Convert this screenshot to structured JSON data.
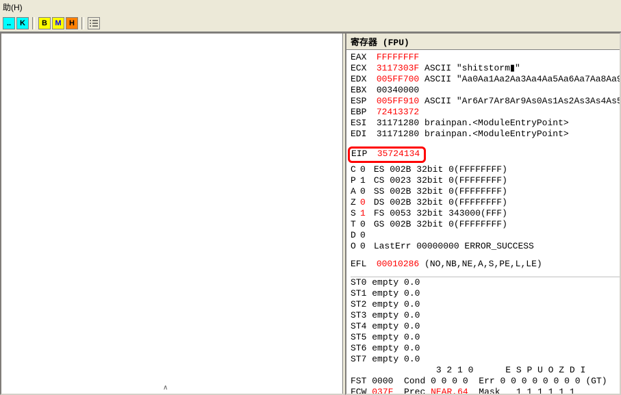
{
  "menu": {
    "help": "助(H)"
  },
  "toolbar": {
    "k": "K",
    "b": "B",
    "m": "M",
    "h": "H"
  },
  "panel": {
    "title": "寄存器 (FPU)"
  },
  "reg": {
    "eax": {
      "name": "EAX",
      "val": "FFFFFFFF"
    },
    "ecx": {
      "name": "ECX",
      "val": "3117303F",
      "asc": "ASCII \"shitstorm▮\""
    },
    "edx": {
      "name": "EDX",
      "val": "005FF700",
      "asc": "ASCII \"Aa0Aa1Aa2Aa3Aa4Aa5Aa6Aa7Aa8Aa9"
    },
    "ebx": {
      "name": "EBX",
      "val": "00340000"
    },
    "esp": {
      "name": "ESP",
      "val": "005FF910",
      "asc": "ASCII \"Ar6Ar7Ar8Ar9As0As1As2As3As4As5"
    },
    "ebp": {
      "name": "EBP",
      "val": "72413372"
    },
    "esi": {
      "name": "ESI",
      "val": "31171280",
      "asc": "brainpan.<ModuleEntryPoint>"
    },
    "edi": {
      "name": "EDI",
      "val": "31171280",
      "asc": "brainpan.<ModuleEntryPoint>"
    },
    "eip": {
      "name": "EIP",
      "val": "35724134"
    }
  },
  "flags": {
    "c": {
      "name": "C",
      "val": "0",
      "seg": "ES",
      "segval": "002B",
      "bits": "32bit",
      "range": "0(FFFFFFFF)"
    },
    "p": {
      "name": "P",
      "val": "1",
      "seg": "CS",
      "segval": "0023",
      "bits": "32bit",
      "range": "0(FFFFFFFF)"
    },
    "a": {
      "name": "A",
      "val": "0",
      "seg": "SS",
      "segval": "002B",
      "bits": "32bit",
      "range": "0(FFFFFFFF)"
    },
    "z": {
      "name": "Z",
      "val": "0",
      "seg": "DS",
      "segval": "002B",
      "bits": "32bit",
      "range": "0(FFFFFFFF)"
    },
    "s": {
      "name": "S",
      "val": "1",
      "seg": "FS",
      "segval": "0053",
      "bits": "32bit",
      "range": "343000(FFF)"
    },
    "t": {
      "name": "T",
      "val": "0",
      "seg": "GS",
      "segval": "002B",
      "bits": "32bit",
      "range": "0(FFFFFFFF)"
    },
    "d": {
      "name": "D",
      "val": "0"
    },
    "o": {
      "name": "O",
      "val": "0",
      "lasterr": "LastErr 00000000 ERROR_SUCCESS"
    }
  },
  "efl": {
    "name": "EFL",
    "val": "00010286",
    "desc": "(NO,NB,NE,A,S,PE,L,LE)"
  },
  "fpu": {
    "st0": {
      "name": "ST0",
      "state": "empty",
      "val": "0.0"
    },
    "st1": {
      "name": "ST1",
      "state": "empty",
      "val": "0.0"
    },
    "st2": {
      "name": "ST2",
      "state": "empty",
      "val": "0.0"
    },
    "st3": {
      "name": "ST3",
      "state": "empty",
      "val": "0.0"
    },
    "st4": {
      "name": "ST4",
      "state": "empty",
      "val": "0.0"
    },
    "st5": {
      "name": "ST5",
      "state": "empty",
      "val": "0.0"
    },
    "st6": {
      "name": "ST6",
      "state": "empty",
      "val": "0.0"
    },
    "st7": {
      "name": "ST7",
      "state": "empty",
      "val": "0.0"
    }
  },
  "fst": {
    "prefix": "FST",
    "val": "0000",
    "cond_label": "Cond",
    "cond_bits": "0 0 0 0",
    "err_label": "Err",
    "err_bits": "0 0 0 0 0 0 0 0",
    "gt": "(GT)"
  },
  "fcw": {
    "prefix": "FCW",
    "val": "037F",
    "prec_label": "Prec",
    "prec": "NEAR,64",
    "mask_label": "Mask",
    "mask_bits": "1 1 1 1 1 1"
  },
  "hdr3210": "3 2 1 0",
  "hdrESPUOZDI": "E S P U O Z D I"
}
